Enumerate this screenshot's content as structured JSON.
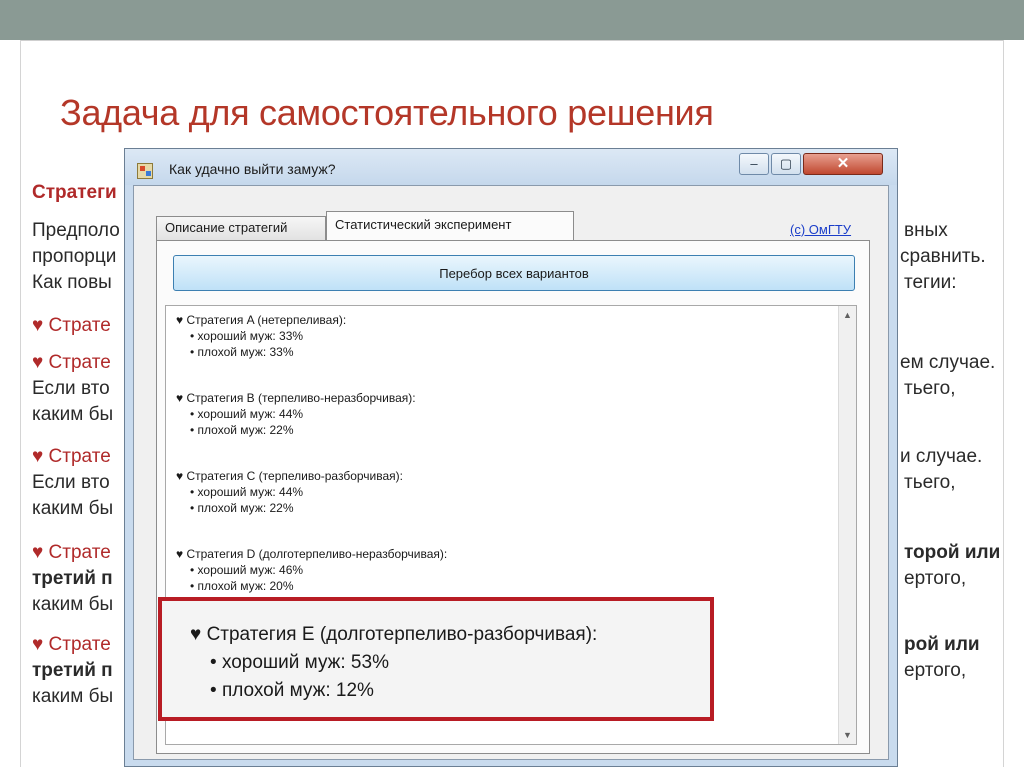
{
  "slide": {
    "title": "Задача для самостоятельного решения",
    "bg_left": [
      "Стратеги",
      "Предполо",
      "пропорци",
      "Как повы",
      "♥ Страте",
      "♥ Страте",
      "Если вто",
      "каким бы",
      "♥ Страте",
      "Если вто",
      "каким бы",
      "♥ Страте",
      "третий п",
      "каким бы",
      "♥ Страте",
      "третий п",
      "каким бы"
    ],
    "bg_right": [
      "вных",
      "сравнить.",
      "тегии:",
      "ем случае.",
      "тьего,",
      "и случае.",
      "тьего,",
      "торой или",
      "ертого,",
      "рой или",
      "ертого,"
    ]
  },
  "window": {
    "title": "Как удачно выйти замуж?",
    "controls": {
      "minimize": "‒",
      "maximize": "▢",
      "close": "✕"
    },
    "tabs": [
      {
        "label": "Описание стратегий",
        "active": false
      },
      {
        "label": "Статистический эксперимент",
        "active": true
      }
    ],
    "link": "(c) ОмГТУ",
    "run_button": "Перебор всех вариантов",
    "strategies": [
      {
        "name": "Стратегия A (нетерпеливая):",
        "good": "хороший муж: 33%",
        "bad": "плохой муж: 33%"
      },
      {
        "name": "Стратегия B (терпеливо-неразборчивая):",
        "good": "хороший муж: 44%",
        "bad": "плохой муж: 22%"
      },
      {
        "name": "Стратегия C (терпеливо-разборчивая):",
        "good": "хороший муж: 44%",
        "bad": "плохой муж: 22%"
      },
      {
        "name": "Стратегия D (долготерпеливо-неразборчивая):",
        "good": "хороший муж: 46%",
        "bad": "плохой муж: 20%"
      },
      {
        "name": "Стратегия E (долготерпеливо-разборчивая):",
        "good": "хороший муж: 53%",
        "bad": "плохой муж: 12%"
      }
    ],
    "heart_glyph": "♥",
    "bullet_glyph": "•"
  },
  "colors": {
    "title_red": "#b43728",
    "highlight_red": "#b81c24",
    "link_blue": "#1a3dc9",
    "topbar": "#8a9a94"
  }
}
